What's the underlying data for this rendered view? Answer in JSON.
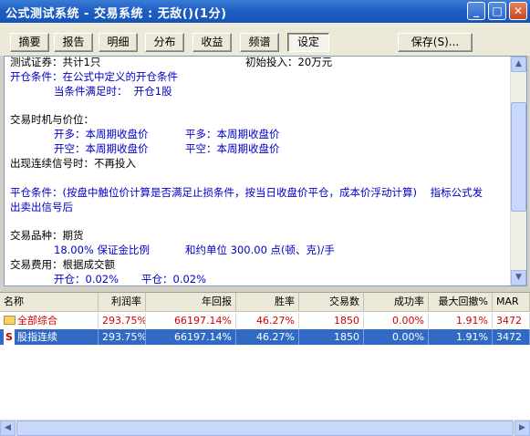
{
  "window": {
    "title": "公式测试系统 - 交易系统 : 无敌()(1分)",
    "min_glyph": "_",
    "max_glyph": "□",
    "close_glyph": "✕"
  },
  "toolbar": {
    "tabs": [
      "摘要",
      "报告",
      "明细",
      "分布",
      "收益",
      "频谱",
      "设定"
    ],
    "active_tab": "设定",
    "save_label": "保存(S)..."
  },
  "settings_text": {
    "l1a": "测试证券：共计1只",
    "l1b": "初始投入：20万元",
    "l2": "开仓条件：在公式中定义的开仓条件",
    "l3": "当条件满足时：  开仓1股",
    "l4": "交易时机与价位：",
    "l5a": "开多：本周期收盘价",
    "l5b": "平多：本周期收盘价",
    "l6a": "开空：本周期收盘价",
    "l6b": "平空：本周期收盘价",
    "l7": "出现连续信号时：不再投入",
    "l8": "平仓条件：(按盘中触位价计算是否满足止损条件，按当日收盘价平仓，成本价浮动计算)    指标公式发",
    "l9": "出卖出信号后",
    "l10": "交易品种：期货",
    "l11a": "18.00% 保证金比例",
    "l11b": "和约单位 300.00 点(顿、克)/手",
    "l12": "交易费用：根据成交额",
    "l13a": "开仓：0.02%",
    "l13b": "平仓：0.02%"
  },
  "grid": {
    "columns": [
      "名称",
      "利润率",
      "年回报",
      "胜率",
      "交易数",
      "成功率",
      "最大回撤%",
      "MAR"
    ],
    "rows": [
      {
        "icon": "folder-icon",
        "name": "全部综合",
        "cells": [
          "293.75%",
          "66197.14%",
          "46.27%",
          "1850",
          "0.00%",
          "1.91%",
          "3472"
        ]
      },
      {
        "icon": "s-icon",
        "icon_glyph": "S",
        "name": "股指连续",
        "cells": [
          "293.75%",
          "66197.14%",
          "46.27%",
          "1850",
          "0.00%",
          "1.91%",
          "3472"
        ]
      }
    ]
  },
  "scroll": {
    "up": "▲",
    "down": "▼",
    "left": "◀",
    "right": "▶"
  },
  "colors": {
    "title_bar": "#1f5fc4",
    "selection": "#316ac5",
    "text_blue": "#0000c8",
    "row_red": "#d40000"
  }
}
